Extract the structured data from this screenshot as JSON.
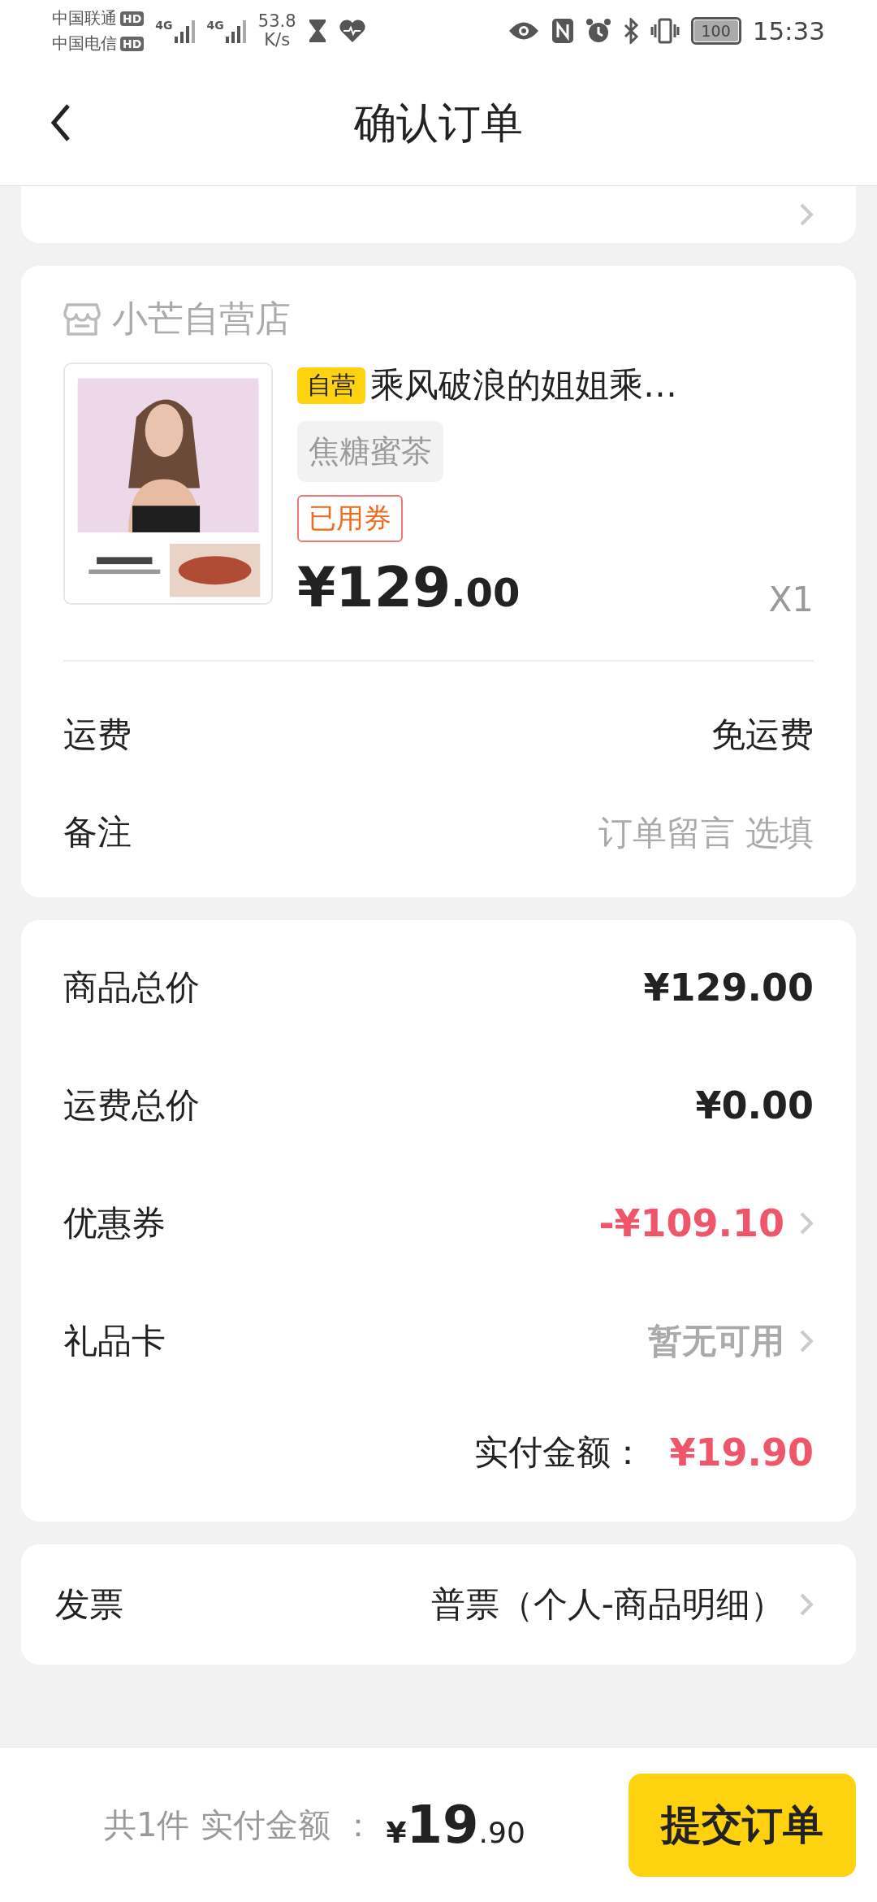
{
  "status_bar": {
    "carriers": [
      "中国联通",
      "中国电信"
    ],
    "hd": [
      "HD",
      "HD"
    ],
    "net": [
      "4G",
      "4G"
    ],
    "speed": [
      "53.8",
      "K/s"
    ],
    "battery": "100",
    "time": "15:33"
  },
  "header": {
    "title": "确认订单"
  },
  "shop": {
    "name": "小芒自营店",
    "product": {
      "tag": "自营",
      "title": "乘风破浪的姐姐乘…",
      "variant": "焦糖蜜茶",
      "coupon_badge": "已用券",
      "price_main": "¥129",
      "price_cents": ".00",
      "quantity": "X1"
    },
    "rows": [
      {
        "label": "运费",
        "value": "免运费",
        "kind": "value"
      },
      {
        "label": "备注",
        "placeholder": "订单留言 选填",
        "kind": "placeholder"
      }
    ]
  },
  "summary": {
    "rows": [
      {
        "label": "商品总价",
        "value": "¥129.00",
        "kind": "amount",
        "chevron": false
      },
      {
        "label": "运费总价",
        "value": "¥0.00",
        "kind": "amount",
        "chevron": false
      },
      {
        "label": "优惠券",
        "value": "-¥109.10",
        "kind": "discount",
        "chevron": true
      },
      {
        "label": "礼品卡",
        "value": "暂无可用",
        "kind": "muted",
        "chevron": true
      }
    ],
    "total_label": "实付金额：",
    "total_value": "¥19.90"
  },
  "invoice": {
    "label": "发票",
    "value": "普票（个人-商品明细）"
  },
  "footer": {
    "count": "共1件",
    "label": "实付金额",
    "colon": "：",
    "currency": "¥",
    "amount": "19",
    "cents": ".90",
    "submit": "提交订单"
  }
}
